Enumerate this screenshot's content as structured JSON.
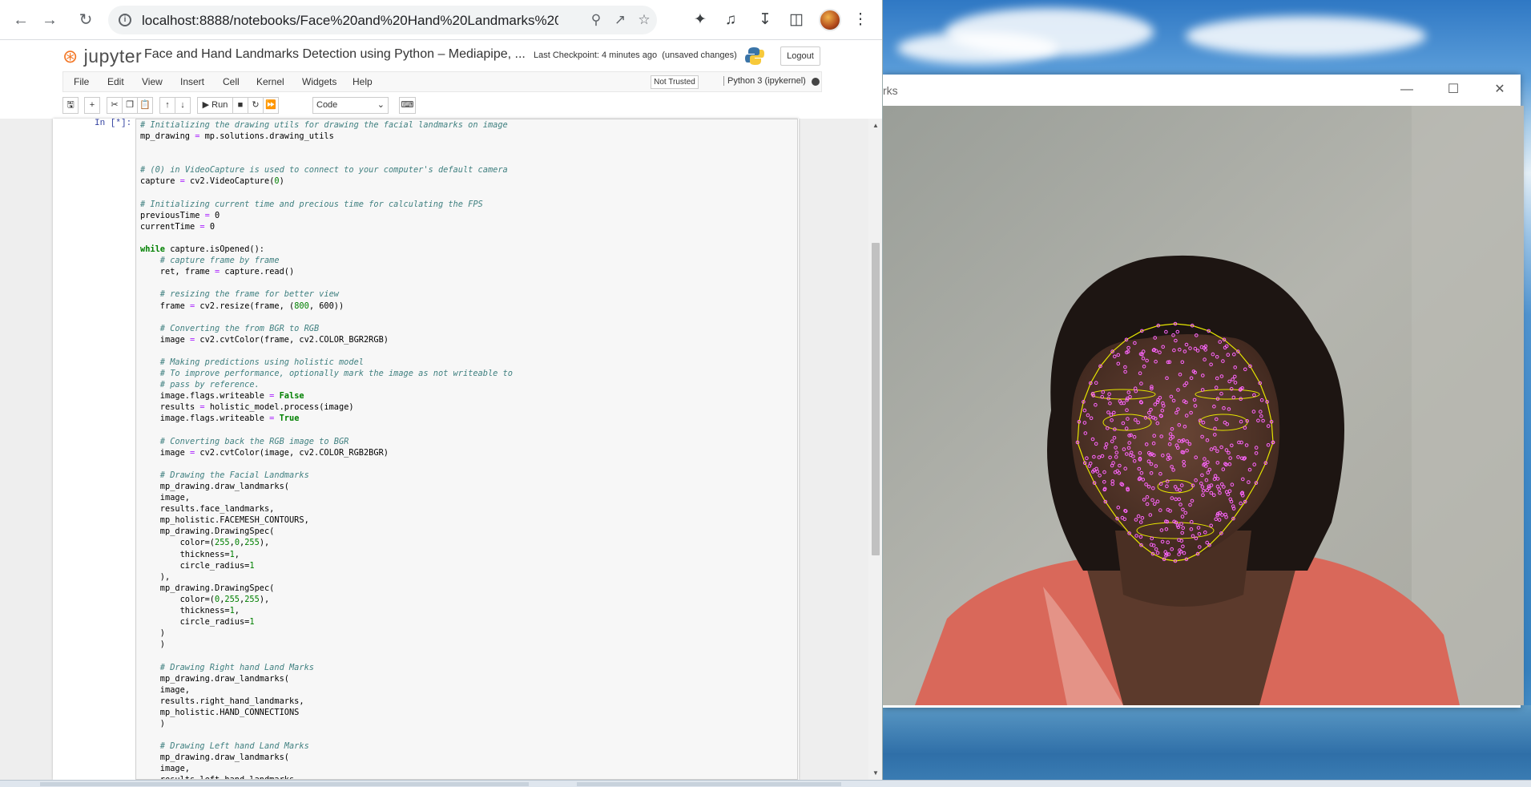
{
  "browser": {
    "url": "localhost:8888/notebooks/Face%20and%20Hand%20Landmarks%20...",
    "icons": [
      "back-icon",
      "forward-icon",
      "reload-icon",
      "info-icon",
      "zoom-icon",
      "share-icon",
      "star-icon",
      "extensions-icon",
      "media-icon",
      "download-icon",
      "sidepanel-icon",
      "profile-avatar",
      "menu-icon"
    ]
  },
  "jupyter": {
    "logo": "jupyter",
    "title": "Face and Hand Landmarks Detection using Python – Mediapipe, ...",
    "checkpoint": "Last Checkpoint: 4 minutes ago",
    "unsaved": "(unsaved changes)",
    "logout": "Logout",
    "menu": [
      "File",
      "Edit",
      "View",
      "Insert",
      "Cell",
      "Kernel",
      "Widgets",
      "Help"
    ],
    "trusted": "Not Trusted",
    "kernel": "Python 3 (ipykernel)",
    "run_label": "Run",
    "cell_type": "Code",
    "prompt": "In [*]:"
  },
  "code_lines": [
    "# Initializing the drawing utils for drawing the facial landmarks on image",
    "mp_drawing = mp.solutions.drawing_utils",
    "",
    "",
    "# (0) in VideoCapture is used to connect to your computer's default camera",
    "capture = cv2.VideoCapture(0)",
    "",
    "# Initializing current time and precious time for calculating the FPS",
    "previousTime = 0",
    "currentTime = 0",
    "",
    "while capture.isOpened():",
    "    # capture frame by frame",
    "    ret, frame = capture.read()",
    "",
    "    # resizing the frame for better view",
    "    frame = cv2.resize(frame, (800, 600))",
    "",
    "    # Converting the from BGR to RGB",
    "    image = cv2.cvtColor(frame, cv2.COLOR_BGR2RGB)",
    "",
    "    # Making predictions using holistic model",
    "    # To improve performance, optionally mark the image as not writeable to",
    "    # pass by reference.",
    "    image.flags.writeable = False",
    "    results = holistic_model.process(image)",
    "    image.flags.writeable = True",
    "",
    "    # Converting back the RGB image to BGR",
    "    image = cv2.cvtColor(image, cv2.COLOR_RGB2BGR)",
    "",
    "    # Drawing the Facial Landmarks",
    "    mp_drawing.draw_landmarks(",
    "    image,",
    "    results.face_landmarks,",
    "    mp_holistic.FACEMESH_CONTOURS,",
    "    mp_drawing.DrawingSpec(",
    "        color=(255,0,255),",
    "        thickness=1,",
    "        circle_radius=1",
    "    ),",
    "    mp_drawing.DrawingSpec(",
    "        color=(0,255,255),",
    "        thickness=1,",
    "        circle_radius=1",
    "    )",
    "    )",
    "",
    "    # Drawing Right hand Land Marks",
    "    mp_drawing.draw_landmarks(",
    "    image,",
    "    results.right_hand_landmarks,",
    "    mp_holistic.HAND_CONNECTIONS",
    "    )",
    "",
    "    # Drawing Left hand Land Marks",
    "    mp_drawing.draw_landmarks(",
    "    image,",
    "    results.left_hand_landmarks,"
  ],
  "video_window": {
    "title": "rks",
    "landmark_color": "#ff66ff",
    "contour_color": "#e6e600"
  },
  "colors": {
    "comment": "#408080",
    "keyword": "#008000",
    "number": "#008000",
    "jupyter_orange": "#f37726"
  }
}
